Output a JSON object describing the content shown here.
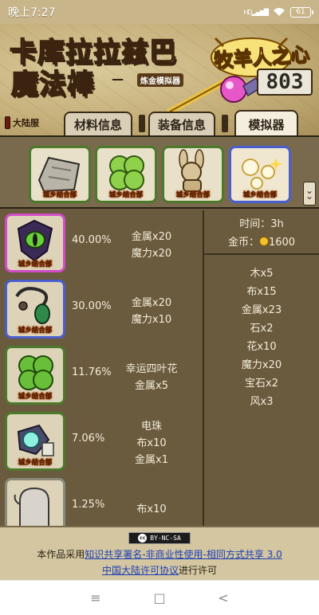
{
  "status_bar": {
    "time": "晚上7:27",
    "signal": "HD",
    "battery": "61"
  },
  "header": {
    "title_line1": "卡库拉拉兹巴",
    "title_line2": "魔法棒",
    "subtitle_dash": "—",
    "subtitle": "炼金模拟器",
    "logo_text": "牧羊人之心",
    "score": "803"
  },
  "tabs": {
    "server_label": "大陆服",
    "items": [
      {
        "label": "材料信息",
        "active": false
      },
      {
        "label": "装备信息",
        "active": false
      },
      {
        "label": "模拟器",
        "active": true
      }
    ]
  },
  "top_icons": [
    {
      "caption": "城乡结合部",
      "icon": "stone-slab-icon",
      "selected": false
    },
    {
      "caption": "城乡结合部",
      "icon": "four-leaf-clover-icon",
      "selected": false
    },
    {
      "caption": "城乡结合部",
      "icon": "rag-doll-icon",
      "selected": false
    },
    {
      "caption": "城乡结合部",
      "icon": "sparkle-pearls-icon",
      "selected": true
    }
  ],
  "recipes": [
    {
      "caption": "城乡结合部",
      "icon": "eye-amulet-icon",
      "frame": "pink",
      "percent": "40.00%",
      "materials": [
        "金属x20",
        "魔力x20"
      ]
    },
    {
      "caption": "城乡结合部",
      "icon": "beetle-necklace-icon",
      "frame": "blue",
      "percent": "30.00%",
      "materials": [
        "金属x20",
        "魔力x10"
      ]
    },
    {
      "caption": "城乡结合部",
      "icon": "four-leaf-clover-icon",
      "frame": "green",
      "percent": "11.76%",
      "materials": [
        "幸运四叶花",
        "金属x5"
      ]
    },
    {
      "caption": "城乡结合部",
      "icon": "orb-gauntlet-icon",
      "frame": "green",
      "percent": "7.06%",
      "materials": [
        "电珠",
        "布x10",
        "金属x1"
      ]
    },
    {
      "caption": "",
      "icon": "cloth-mitten-icon",
      "frame": "gray",
      "percent": "1.25%",
      "materials": [
        "布x10"
      ]
    }
  ],
  "summary": {
    "time": "时间：3h",
    "gold_label": "金币：",
    "gold_value": "1600",
    "totals": [
      "木x5",
      "布x15",
      "金属x23",
      "石x2",
      "花x10",
      "魔力x20",
      "宝石x2",
      "风x3"
    ]
  },
  "footer": {
    "cc_badge": "BY-NC-SA",
    "license_prefix": "本作品采用",
    "license_link1": "知识共享署名-非商业性使用-相同方式共享 3.0",
    "license_link2": "中国大陆许可协议",
    "license_suffix": "进行许可"
  },
  "navbar": {
    "menu": "≡",
    "home": "□",
    "back": "<"
  },
  "colors": {
    "accent_green": "#4b7a2b",
    "accent_blue": "#4a5fcf",
    "accent_pink": "#d14cc9",
    "panel": "#6a5a3e"
  }
}
